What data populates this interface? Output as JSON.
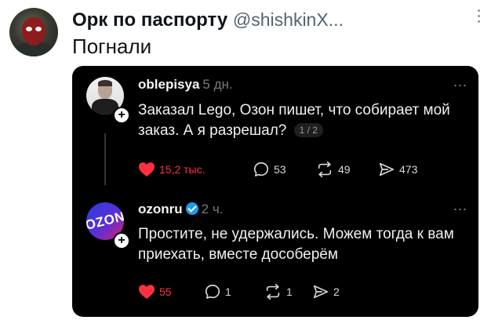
{
  "outer": {
    "name": "Орк по паспорту",
    "handle": "@shishkinX...",
    "text": "Погнали"
  },
  "posts": [
    {
      "username": "oblepisya",
      "time": "5 дн.",
      "text": "Заказал Lego, Озон пишет, что собирает мой заказ. А я разрешал?",
      "pager": "1 / 2",
      "likes": "15,2 тыс.",
      "comments": "53",
      "reposts": "49",
      "shares": "473"
    },
    {
      "username": "ozonru",
      "time": "2 ч.",
      "verified": true,
      "avatar_logo": "OZON",
      "text": "Простите, не удержались. Можем тогда к вам приехать, вместе дособерём",
      "likes": "55",
      "comments": "1",
      "reposts": "1",
      "shares": "2"
    }
  ],
  "more_label": "...",
  "colors": {
    "like": "#ff3040",
    "verified": "#1d9bf0",
    "card_bg": "#000000"
  }
}
